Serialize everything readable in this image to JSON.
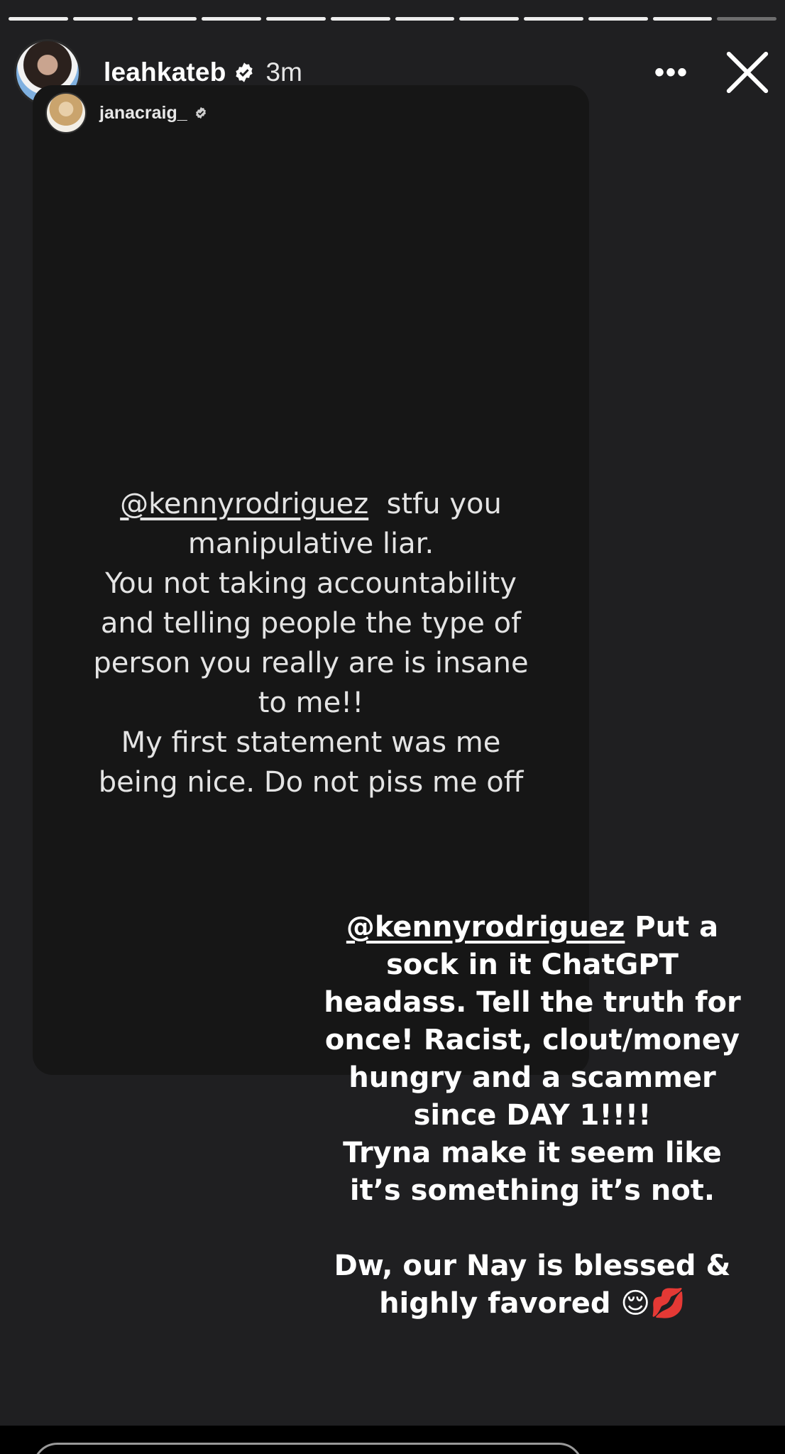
{
  "story": {
    "segments_total": 12,
    "segments_completed": 11
  },
  "header": {
    "username": "leahkateb",
    "time_ago": "3m",
    "more_label": "•••",
    "verified_icon": "verified-badge-icon",
    "close_icon": "close-icon"
  },
  "reshared_post": {
    "username": "janacraig_",
    "mention": "@kennyrodriguez",
    "text_after_mention": "  stfu you",
    "lines": [
      "manipulative liar.",
      "You not taking accountability",
      "and telling people the type of",
      "person you really are is insane",
      "to me!!",
      "My first statement was me",
      "being nice. Do not piss me off"
    ]
  },
  "caption": {
    "mention": "@kennyrodriguez",
    "first_line_rest": " Put a",
    "lines": [
      "sock in it ChatGPT",
      "headass. Tell the truth for",
      "once! Racist, clout/money",
      "hungry and a scammer",
      "since DAY 1!!!!",
      "Tryna make it seem like",
      "it’s something it’s not."
    ],
    "closing_lines": [
      "Dw, our Nay is blessed &",
      "highly favored 😌💋"
    ]
  },
  "colors": {
    "background": "#1f1f21",
    "card": "#161616",
    "text": "#ffffff"
  }
}
